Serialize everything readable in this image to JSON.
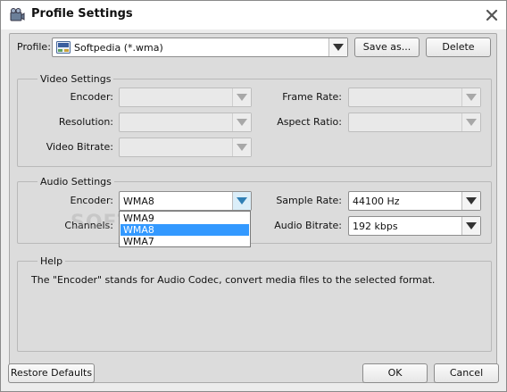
{
  "window": {
    "title": "Profile Settings"
  },
  "profile": {
    "label": "Profile:",
    "value": "Softpedia (*.wma)",
    "icon_text": "WMA",
    "save_as": "Save as...",
    "delete": "Delete"
  },
  "video": {
    "title": "Video Settings",
    "encoder_label": "Encoder:",
    "frame_rate_label": "Frame Rate:",
    "resolution_label": "Resolution:",
    "aspect_ratio_label": "Aspect Ratio:",
    "bitrate_label": "Video Bitrate:"
  },
  "audio": {
    "title": "Audio Settings",
    "encoder_label": "Encoder:",
    "encoder_value": "WMA8",
    "channels_label": "Channels:",
    "sample_rate_label": "Sample Rate:",
    "sample_rate_value": "44100 Hz",
    "bitrate_label": "Audio Bitrate:",
    "bitrate_value": "192 kbps",
    "encoder_options": [
      "WMA9",
      "WMA8",
      "WMA7"
    ],
    "selected_option": "WMA8"
  },
  "help": {
    "title": "Help",
    "text": "The \"Encoder\" stands for Audio Codec, convert media files to the selected format."
  },
  "footer": {
    "restore": "Restore Defaults",
    "ok": "OK",
    "cancel": "Cancel"
  },
  "watermark": "SOFTPEDIA",
  "colors": {
    "selection": "#3399ff",
    "panel": "#dcdcdc"
  }
}
